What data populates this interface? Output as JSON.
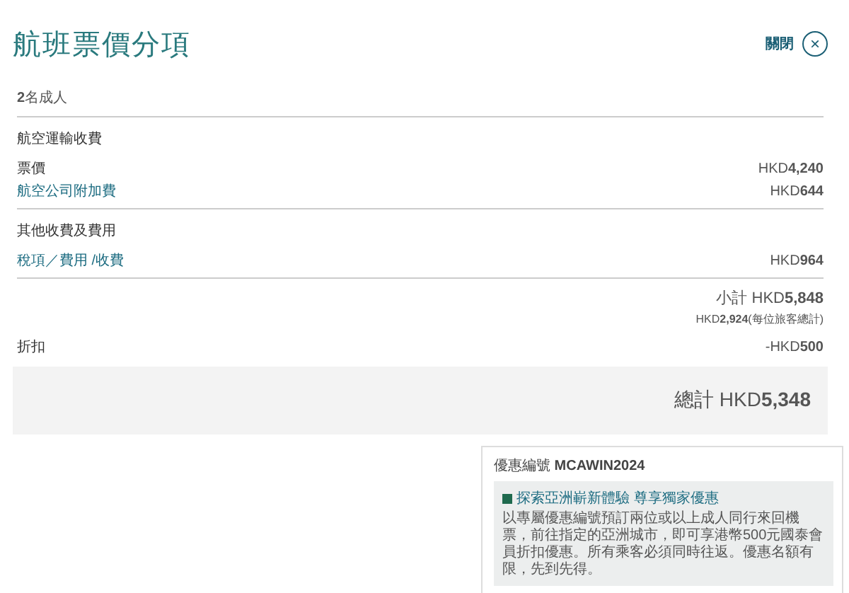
{
  "title": "航班票價分項",
  "close": {
    "label": "關閉",
    "icon": "×"
  },
  "passengers": "**2**名成人",
  "sections": [
    {
      "heading": "航空運輸收費",
      "items": [
        {
          "label": "票價",
          "kind": "plain",
          "amount": "HKD**4,240**"
        },
        {
          "label": "航空公司附加費",
          "kind": "link",
          "amount": "HKD**644**"
        }
      ]
    },
    {
      "heading": "其他收費及費用",
      "items": [
        {
          "label": "稅項／費用 /收費",
          "kind": "link",
          "amount": "HKD**964**"
        }
      ]
    }
  ],
  "subtotal": "小計 HKD**5,848**",
  "per_traveller": "HKD**2,924**(每位旅客總計)",
  "discount": {
    "label": "折扣",
    "amount": "-HKD**500**"
  },
  "total": "總計 HKD**5,348**",
  "promo": {
    "code": "優惠編號 **MCAWIN2024**",
    "headline": "探索亞洲嶄新體驗 尊享獨家優惠",
    "body": "以專屬優惠編號預訂兩位或以上成人同行來回機票，前往指定的亞洲城市，即可享港幣500元國泰會員折扣優惠。所有乘客必須同時往返。優惠名額有限，先到先得。"
  }
}
